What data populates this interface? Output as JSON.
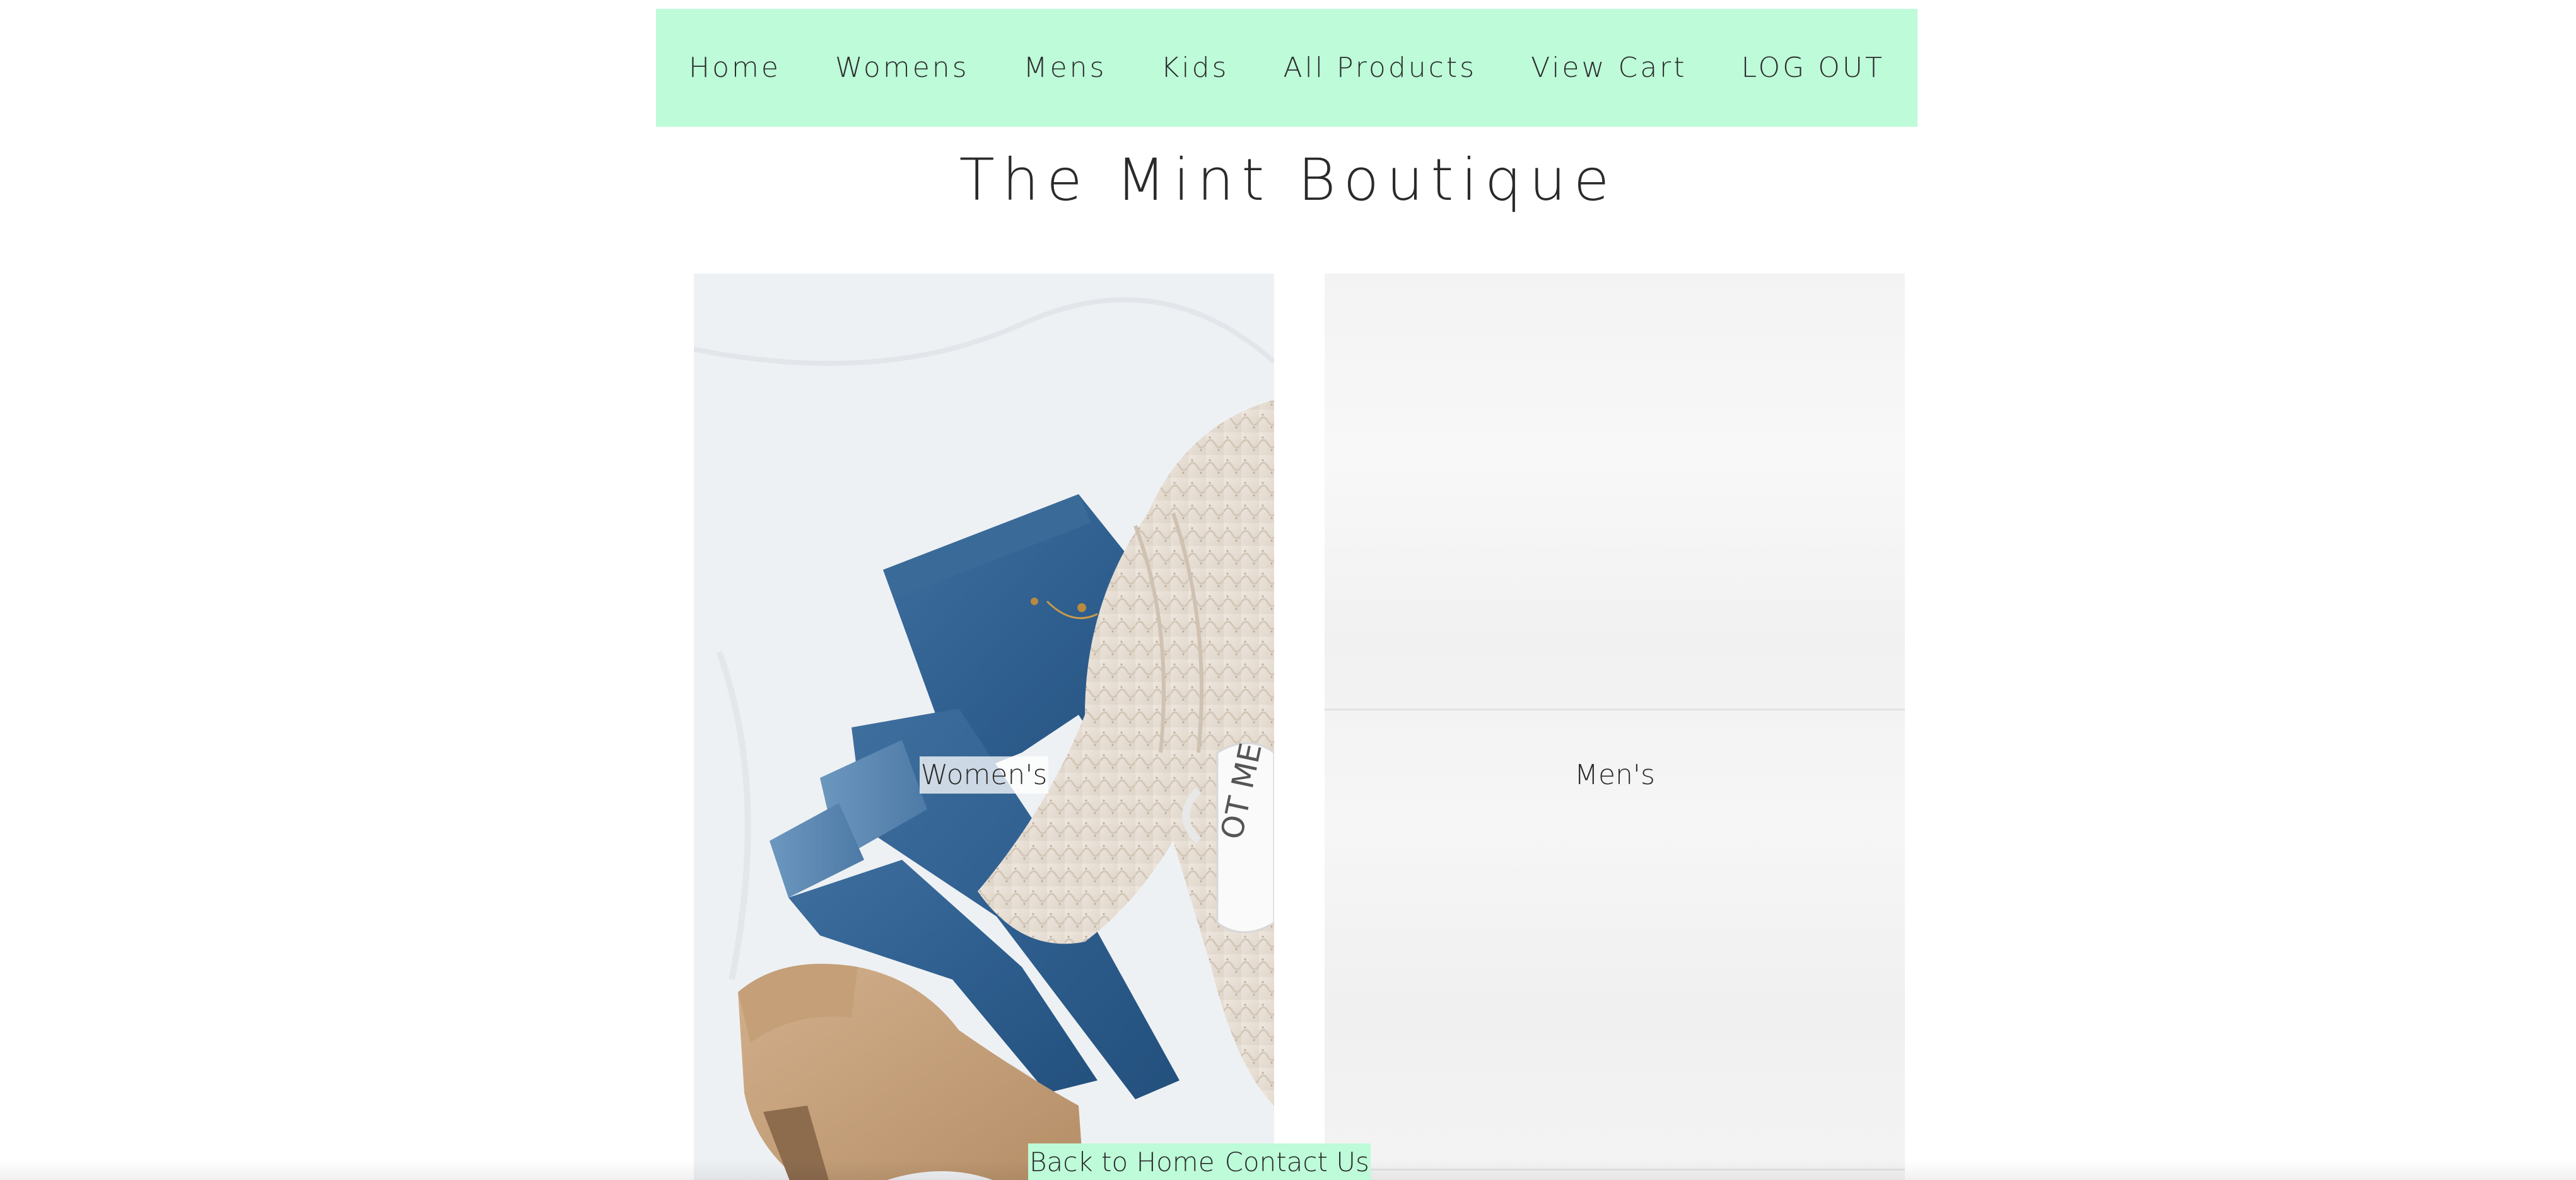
{
  "nav": {
    "items": [
      {
        "label": "Home"
      },
      {
        "label": "Womens"
      },
      {
        "label": "Mens"
      },
      {
        "label": "Kids"
      },
      {
        "label": "All Products"
      },
      {
        "label": "View Cart"
      },
      {
        "label": "LOG OUT"
      }
    ]
  },
  "site": {
    "title": "The Mint Boutique"
  },
  "categories": [
    {
      "label": "Women's",
      "image": "flat-lay-jeans-sweater-boots-photo"
    },
    {
      "label": "Men's",
      "image": "white-wood-planks-photo"
    }
  ],
  "footer": {
    "back_home": "Back to Home",
    "contact": "Contact Us"
  },
  "colors": {
    "mint_accent": "#bdfbd9",
    "text": "#2a2a2a",
    "background": "#ffffff"
  }
}
